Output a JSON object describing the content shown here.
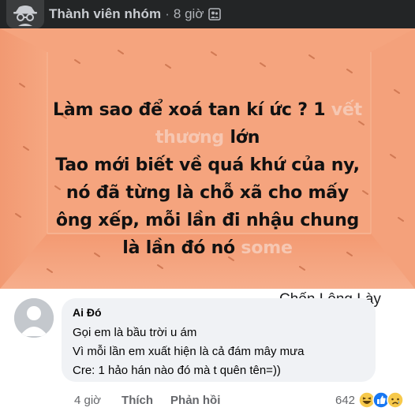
{
  "post_header": {
    "author": "Thành viên nhóm",
    "separator": "·",
    "time": "8 giờ",
    "privacy_icon": "group-privacy-icon"
  },
  "post_image": {
    "lines": [
      [
        "Làm sao để xoá tan kí ức ? 1 ",
        "vết"
      ],
      [
        "thương",
        " lớn"
      ],
      [
        "Tao mới biết về quá khứ của ny,",
        ""
      ],
      [
        "nó đã từng là chỗ xã cho mấy",
        ""
      ],
      [
        "ông xếp, mỗi lần đi nhậu chung",
        ""
      ],
      [
        "là lần đó nó ",
        "some"
      ]
    ],
    "background_color": "#f4a07a"
  },
  "watermark": "Chốn Lông Lày",
  "comment": {
    "author": "Ai Đó",
    "lines": [
      "Gọi em là bầu trời u ám",
      "Vì mỗi lần em xuất hiện là cả đám mây mưa",
      "Cre: 1 hảo hán nào đó mà t quên tên=))"
    ],
    "time": "4 giờ",
    "like_label": "Thích",
    "reply_label": "Phản hồi",
    "reaction_count": "642",
    "reaction_icons": [
      "haha-icon",
      "like-icon",
      "sad-icon"
    ]
  }
}
